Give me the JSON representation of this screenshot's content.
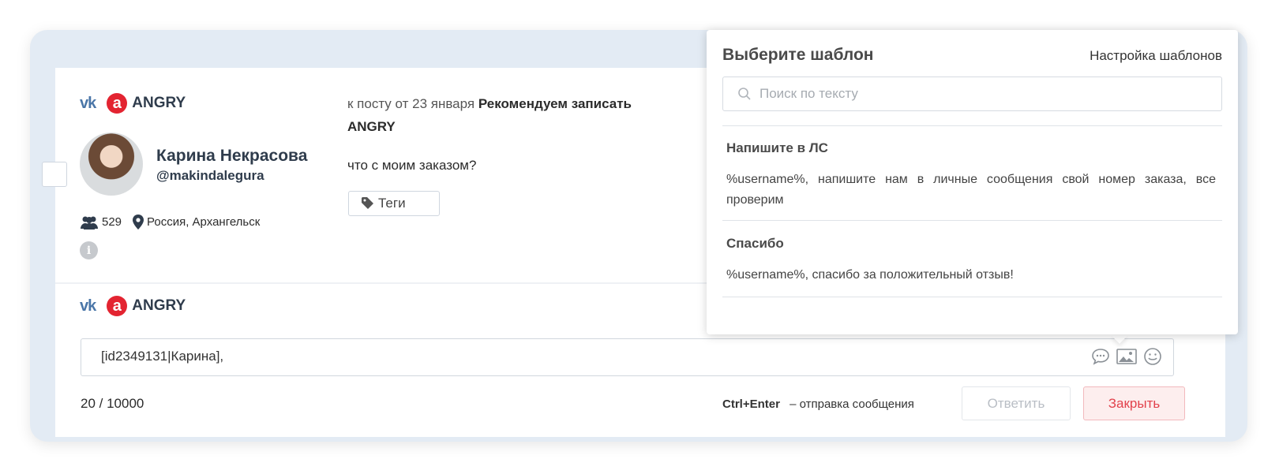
{
  "post": {
    "brand": "ANGRY",
    "author_name": "Карина Некрасова",
    "author_handle": "@makindalegura",
    "followers": "529",
    "location": "Россия, Архангельск",
    "ref_prefix": "к посту от 23 января",
    "ref_title": "Рекомендуем записать",
    "ref_title_2": "ANGRY",
    "message": "что с моим заказом?",
    "tags_label": "Теги"
  },
  "reply": {
    "brand": "ANGRY",
    "text": "[id2349131|Карина],",
    "counter": "20 / 10000",
    "hotkey": "Ctrl+Enter",
    "hotkey_desc": "– отправка сообщения",
    "reply_label": "Ответить",
    "close_label": "Закрыть"
  },
  "templates": {
    "title": "Выберите шаблон",
    "settings_label": "Настройка шаблонов",
    "search_placeholder": "Поиск по тексту",
    "items": [
      {
        "title": "Напишите в ЛС",
        "body": "%username%, напишите нам в личные сообщения свой номер заказа, все проверим"
      },
      {
        "title": "Спасибо",
        "body": "%username%, спасибо за положительный отзыв!"
      }
    ]
  },
  "colors": {
    "accent_red": "#e32431",
    "vk_blue": "#4a76a8",
    "frame_bg": "#e3ebf4"
  }
}
